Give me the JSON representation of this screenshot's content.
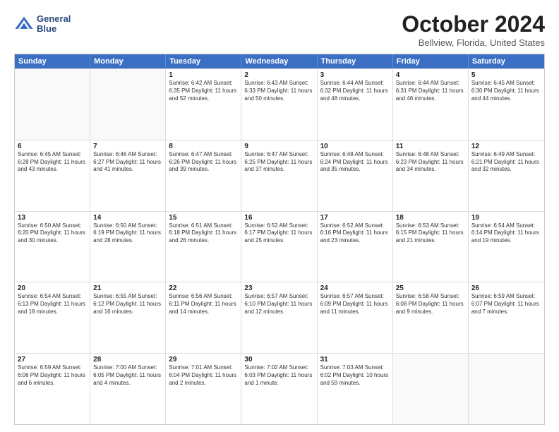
{
  "logo": {
    "line1": "General",
    "line2": "Blue"
  },
  "title": "October 2024",
  "subtitle": "Bellview, Florida, United States",
  "header_days": [
    "Sunday",
    "Monday",
    "Tuesday",
    "Wednesday",
    "Thursday",
    "Friday",
    "Saturday"
  ],
  "rows": [
    [
      {
        "day": "",
        "info": ""
      },
      {
        "day": "",
        "info": ""
      },
      {
        "day": "1",
        "info": "Sunrise: 6:42 AM\nSunset: 6:35 PM\nDaylight: 11 hours and 52 minutes."
      },
      {
        "day": "2",
        "info": "Sunrise: 6:43 AM\nSunset: 6:33 PM\nDaylight: 11 hours and 50 minutes."
      },
      {
        "day": "3",
        "info": "Sunrise: 6:44 AM\nSunset: 6:32 PM\nDaylight: 11 hours and 48 minutes."
      },
      {
        "day": "4",
        "info": "Sunrise: 6:44 AM\nSunset: 6:31 PM\nDaylight: 11 hours and 46 minutes."
      },
      {
        "day": "5",
        "info": "Sunrise: 6:45 AM\nSunset: 6:30 PM\nDaylight: 11 hours and 44 minutes."
      }
    ],
    [
      {
        "day": "6",
        "info": "Sunrise: 6:45 AM\nSunset: 6:28 PM\nDaylight: 11 hours and 43 minutes."
      },
      {
        "day": "7",
        "info": "Sunrise: 6:46 AM\nSunset: 6:27 PM\nDaylight: 11 hours and 41 minutes."
      },
      {
        "day": "8",
        "info": "Sunrise: 6:47 AM\nSunset: 6:26 PM\nDaylight: 11 hours and 39 minutes."
      },
      {
        "day": "9",
        "info": "Sunrise: 6:47 AM\nSunset: 6:25 PM\nDaylight: 11 hours and 37 minutes."
      },
      {
        "day": "10",
        "info": "Sunrise: 6:48 AM\nSunset: 6:24 PM\nDaylight: 11 hours and 35 minutes."
      },
      {
        "day": "11",
        "info": "Sunrise: 6:48 AM\nSunset: 6:23 PM\nDaylight: 11 hours and 34 minutes."
      },
      {
        "day": "12",
        "info": "Sunrise: 6:49 AM\nSunset: 6:21 PM\nDaylight: 11 hours and 32 minutes."
      }
    ],
    [
      {
        "day": "13",
        "info": "Sunrise: 6:50 AM\nSunset: 6:20 PM\nDaylight: 11 hours and 30 minutes."
      },
      {
        "day": "14",
        "info": "Sunrise: 6:50 AM\nSunset: 6:19 PM\nDaylight: 11 hours and 28 minutes."
      },
      {
        "day": "15",
        "info": "Sunrise: 6:51 AM\nSunset: 6:18 PM\nDaylight: 11 hours and 26 minutes."
      },
      {
        "day": "16",
        "info": "Sunrise: 6:52 AM\nSunset: 6:17 PM\nDaylight: 11 hours and 25 minutes."
      },
      {
        "day": "17",
        "info": "Sunrise: 6:52 AM\nSunset: 6:16 PM\nDaylight: 11 hours and 23 minutes."
      },
      {
        "day": "18",
        "info": "Sunrise: 6:53 AM\nSunset: 6:15 PM\nDaylight: 11 hours and 21 minutes."
      },
      {
        "day": "19",
        "info": "Sunrise: 6:54 AM\nSunset: 6:14 PM\nDaylight: 11 hours and 19 minutes."
      }
    ],
    [
      {
        "day": "20",
        "info": "Sunrise: 6:54 AM\nSunset: 6:13 PM\nDaylight: 11 hours and 18 minutes."
      },
      {
        "day": "21",
        "info": "Sunrise: 6:55 AM\nSunset: 6:12 PM\nDaylight: 11 hours and 16 minutes."
      },
      {
        "day": "22",
        "info": "Sunrise: 6:56 AM\nSunset: 6:11 PM\nDaylight: 11 hours and 14 minutes."
      },
      {
        "day": "23",
        "info": "Sunrise: 6:57 AM\nSunset: 6:10 PM\nDaylight: 11 hours and 12 minutes."
      },
      {
        "day": "24",
        "info": "Sunrise: 6:57 AM\nSunset: 6:09 PM\nDaylight: 11 hours and 11 minutes."
      },
      {
        "day": "25",
        "info": "Sunrise: 6:58 AM\nSunset: 6:08 PM\nDaylight: 11 hours and 9 minutes."
      },
      {
        "day": "26",
        "info": "Sunrise: 6:59 AM\nSunset: 6:07 PM\nDaylight: 11 hours and 7 minutes."
      }
    ],
    [
      {
        "day": "27",
        "info": "Sunrise: 6:59 AM\nSunset: 6:06 PM\nDaylight: 11 hours and 6 minutes."
      },
      {
        "day": "28",
        "info": "Sunrise: 7:00 AM\nSunset: 6:05 PM\nDaylight: 11 hours and 4 minutes."
      },
      {
        "day": "29",
        "info": "Sunrise: 7:01 AM\nSunset: 6:04 PM\nDaylight: 11 hours and 2 minutes."
      },
      {
        "day": "30",
        "info": "Sunrise: 7:02 AM\nSunset: 6:03 PM\nDaylight: 11 hours and 1 minute."
      },
      {
        "day": "31",
        "info": "Sunrise: 7:03 AM\nSunset: 6:02 PM\nDaylight: 10 hours and 59 minutes."
      },
      {
        "day": "",
        "info": ""
      },
      {
        "day": "",
        "info": ""
      }
    ]
  ]
}
